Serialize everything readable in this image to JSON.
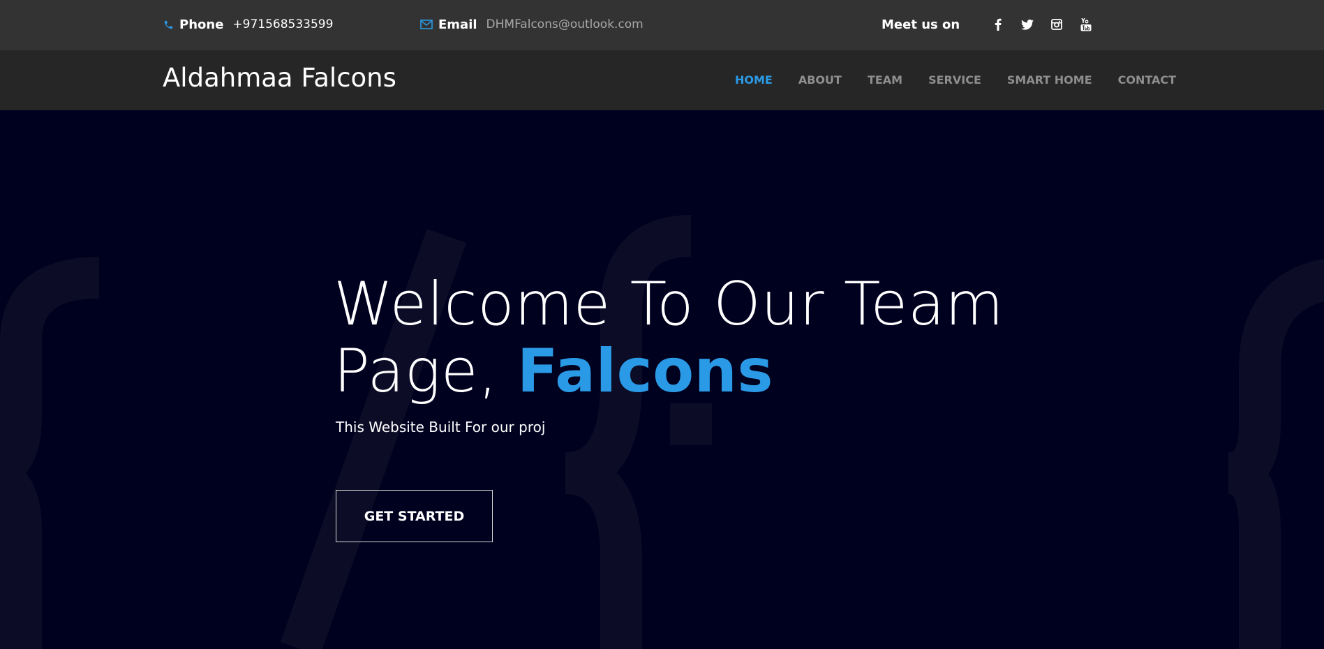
{
  "topbar": {
    "phone": {
      "label": "Phone",
      "value": "+971568533599",
      "icon": "phone-icon"
    },
    "email": {
      "label": "Email",
      "value": "DHMFalcons@outlook.com",
      "icon": "envelope-icon"
    },
    "social": {
      "label": "Meet us on",
      "icons": [
        "facebook-icon",
        "twitter-icon",
        "instagram-icon",
        "youtube-icon"
      ]
    }
  },
  "navbar": {
    "brand": "Aldahmaa Falcons",
    "items": [
      {
        "label": "HOME",
        "active": true
      },
      {
        "label": "ABOUT",
        "active": false
      },
      {
        "label": "TEAM",
        "active": false
      },
      {
        "label": "SERVICE",
        "active": false
      },
      {
        "label": "SMART HOME",
        "active": false
      },
      {
        "label": "CONTACT",
        "active": false
      }
    ]
  },
  "hero": {
    "line1": "Welcome To Our Team",
    "line2_prefix": "Page, ",
    "line2_accent": "Falcons",
    "subtitle": "This Website Built For our proj",
    "cta_label": "GET STARTED"
  },
  "colors": {
    "accent": "#2b9ae6",
    "topbar_bg": "#333333",
    "navbar_bg": "#262626",
    "hero_bg": "#00001f",
    "nav_text": "#8f8f8f"
  }
}
